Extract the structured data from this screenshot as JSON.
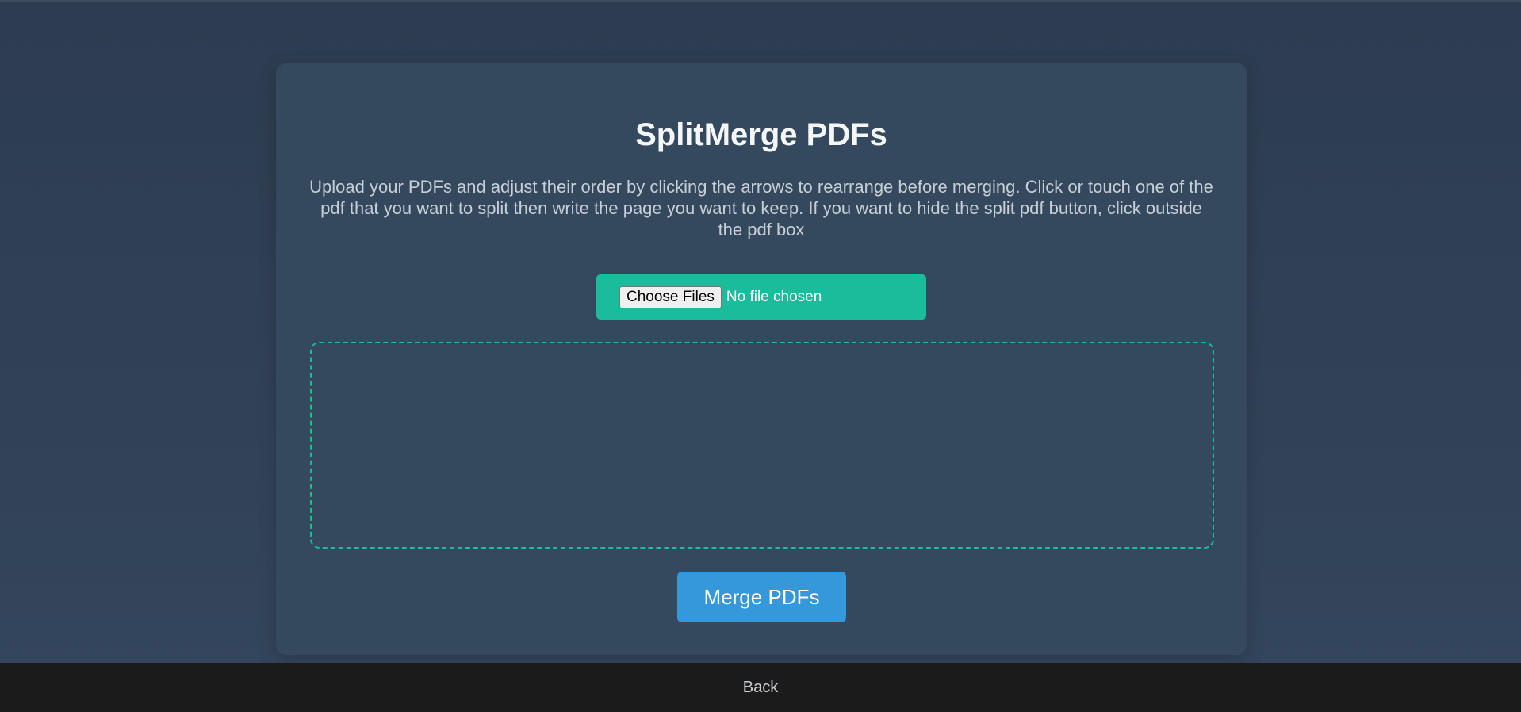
{
  "app": {
    "title": "SplitMerge PDFs",
    "description": "Upload your PDFs and adjust their order by clicking the arrows to rearrange before merging. Click or touch one of the pdf that you want to split then write the page you want to keep. If you want to hide the split pdf button, click outside the pdf box"
  },
  "upload": {
    "button_label": "Choose Files",
    "status_text": "No file chosen"
  },
  "actions": {
    "merge_label": "Merge PDFs"
  },
  "footer": {
    "back_label": "Back"
  },
  "colors": {
    "background": "#2d3c50",
    "card": "#34495e",
    "accent_green": "#1abc9c",
    "accent_blue": "#3498db",
    "footer": "#1b1b1b"
  }
}
